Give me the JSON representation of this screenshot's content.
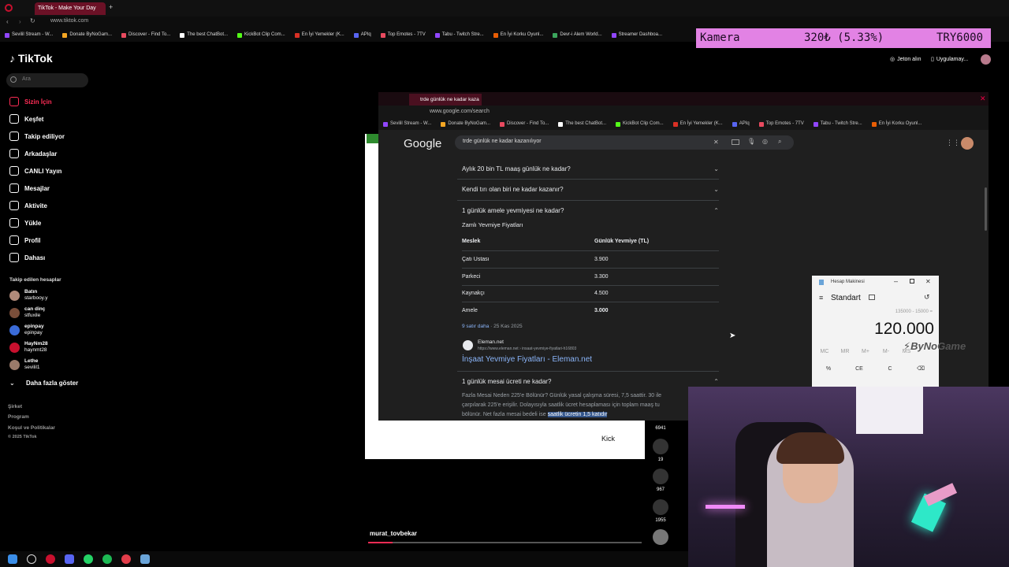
{
  "browser": {
    "tab_title": "TikTok - Make Your Day",
    "url": "www.tiktok.com",
    "bookmarks": [
      "Sevilil Stream - W...",
      "Donate ByNoGam...",
      "Discover - Find To...",
      "The best ChatBot...",
      "KickBot Clip Com...",
      "En İyi Yemekler (K...",
      "APIq",
      "Top Emotes - 7TV",
      "Tabu - Twitch Stre...",
      "En İyi Korku Oyunl...",
      "Devr-i Alem World...",
      "Streamer Dashboa..."
    ]
  },
  "ticker": {
    "label": "Kamera",
    "price": "320₺ (5.33%)",
    "goal": "TRY6000",
    "color": "#e282e4"
  },
  "tiktok": {
    "logo": "TikTok",
    "search_placeholder": "Ara",
    "nav": [
      {
        "label": "Sizin İçin",
        "icon": "home-icon"
      },
      {
        "label": "Keşfet",
        "icon": "compass-icon"
      },
      {
        "label": "Takip ediliyor",
        "icon": "following-icon"
      },
      {
        "label": "Arkadaşlar",
        "icon": "friends-icon"
      },
      {
        "label": "CANLI Yayın",
        "icon": "live-icon"
      },
      {
        "label": "Mesajlar",
        "icon": "messages-icon"
      },
      {
        "label": "Aktivite",
        "icon": "activity-icon"
      },
      {
        "label": "Yükle",
        "icon": "upload-icon"
      },
      {
        "label": "Profil",
        "icon": "profile-icon"
      },
      {
        "label": "Dahası",
        "icon": "more-icon"
      }
    ],
    "following_title": "Takip edilen hesaplar",
    "following": [
      {
        "name": "Batın",
        "handle": "starbooy.y"
      },
      {
        "name": "can dinç",
        "handle": "stfuxile"
      },
      {
        "name": "epinpay",
        "handle": "epinpay"
      },
      {
        "name": "HayNm28",
        "handle": "haynmt28"
      },
      {
        "name": "Lethe",
        "handle": "sevilil1"
      }
    ],
    "show_more": "Daha fazla göster",
    "footer": [
      "Şirket",
      "Program",
      "Koşul ve Politikalar",
      "© 2025 TikTok"
    ],
    "top_right": {
      "coins": "Jeton alın",
      "app": "Uygulamay..."
    },
    "video": {
      "kick_label": "Kick",
      "likes": "6941",
      "comments": "19",
      "saves": "967",
      "shares": "1955",
      "username": "murat_tovbekar",
      "progress": 0.09
    }
  },
  "inner_browser": {
    "tab_title": "trde günlük ne kadar kaza",
    "url": "www.google.com/search",
    "google_logo": "Google",
    "query": "trde günlük ne kadar kazanılıyor",
    "faqs_top": [
      "Aylık 20 bin TL maaş günlük ne kadar?",
      "Kendi tırı olan biri ne kadar kazanır?",
      "1 günlük amele yevmiyesi ne kadar?"
    ],
    "table_title": "Zamlı Yevmiye Fiyatları",
    "table_headers": [
      "Meslek",
      "Günlük Yevmiye (TL)"
    ],
    "table_rows": [
      [
        "Çatı Ustası",
        "3.900"
      ],
      [
        "Parkeci",
        "3.300"
      ],
      [
        "Kaynakçı",
        "4.500"
      ],
      [
        "Amele",
        "3.000"
      ]
    ],
    "more_rows": "9 satır daha",
    "date": "25 Kas 2025",
    "source_name": "Eleman.net",
    "source_url": "https://www.eleman.net › insaat-yevmiye-fiyatlari-h16803",
    "source_title": "İnşaat Yevmiye Fiyatları - Eleman.net",
    "faq_bottom": "1 günlük mesai ücreti ne kadar?",
    "snippet_1": "Fazla Mesai Neden 225'e Bölünür? Günlük yasal çalışma süresi, 7,5 saattir. 30 ile",
    "snippet_2": "çarpılarak 225'e erişilir. Dolayısıyla saatlik ücret hesaplaması için toplam maaş tu",
    "snippet_3a": "bölünür. Net fazla mesai bedeli ise",
    "snippet_3b": "saatlik ücretin 1,5 katıdır"
  },
  "calculator": {
    "title": "Hesap Makinesi",
    "mode": "Standart",
    "expression": "135000 - 15000 =",
    "result": "120.000",
    "mem_keys": [
      "MC",
      "MR",
      "M+",
      "M-",
      "MS"
    ],
    "keys": [
      "%",
      "CE",
      "C",
      "⌫"
    ]
  },
  "watermark": "ByNoGame"
}
